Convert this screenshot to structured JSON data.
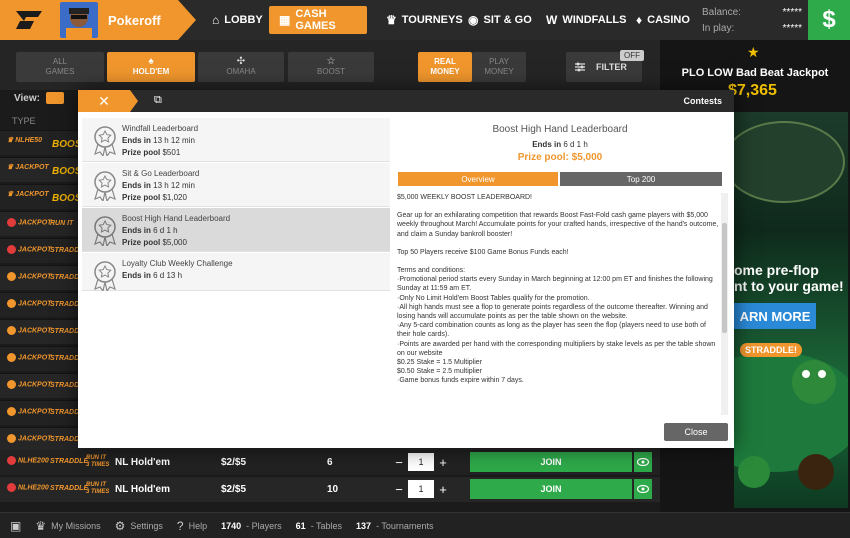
{
  "header": {
    "username": "Pokeroff",
    "nav": [
      {
        "label": "LOBBY",
        "icon": "home-icon",
        "glyph": "⌂"
      },
      {
        "label": "CASH GAMES",
        "icon": "cash-icon",
        "glyph": "▦"
      },
      {
        "label": "TOURNEYS",
        "icon": "trophy-icon",
        "glyph": "♛"
      },
      {
        "label": "SIT & GO",
        "icon": "chip-icon",
        "glyph": "◉"
      },
      {
        "label": "WINDFALLS",
        "icon": "windfall-icon",
        "glyph": "W"
      },
      {
        "label": "CASINO",
        "icon": "casino-icon",
        "glyph": "♦"
      }
    ],
    "balance_label": "Balance:",
    "balance_value": "*****",
    "inplay_label": "In play:",
    "inplay_value": "*****",
    "cashier_symbol": "$"
  },
  "filters": {
    "all_games": [
      "ALL",
      "GAMES"
    ],
    "holdem": "HOLD'EM",
    "omaha": "OMAHA",
    "boost": "BOOST",
    "real_money": [
      "REAL",
      "MONEY"
    ],
    "play_money": [
      "PLAY",
      "MONEY"
    ],
    "filter_label": "FILTER",
    "filter_state": "OFF",
    "view_label": "View:",
    "type_label": "TYPE"
  },
  "side": {
    "jackpot_title": "PLO LOW Bad Beat Jackpot",
    "jackpot_value": "$7,365",
    "ad_line1": "ome pre-flop",
    "ad_line2": "nt to your game!",
    "ad_button": "ARN MORE",
    "ad_tag": "STRADDLE!"
  },
  "list_badges": {
    "jackpot_small": "NLHE50",
    "jackpot_word": "JACKPOT",
    "boost_word": "BOOST",
    "straddle": "STRADDLE",
    "run_it": "RUN IT",
    "three_times": "3 TIMES"
  },
  "modal": {
    "title": "Contests",
    "close_label": "Close",
    "items": [
      {
        "name": "Windfall Leaderboard",
        "ends_label": "Ends in",
        "ends": "13 h 12 min",
        "prize_label": "Prize pool",
        "prize": "$501"
      },
      {
        "name": "Sit & Go Leaderboard",
        "ends_label": "Ends in",
        "ends": "13 h 12 min",
        "prize_label": "Prize pool",
        "prize": "$1,020"
      },
      {
        "name": "Boost High Hand Leaderboard",
        "ends_label": "Ends in",
        "ends": "6 d 1 h",
        "prize_label": "Prize pool",
        "prize": "$5,000"
      },
      {
        "name": "Loyalty Club Weekly Challenge",
        "ends_label": "Ends in",
        "ends": "6 d 13 h",
        "prize_label": "",
        "prize": ""
      }
    ],
    "detail": {
      "title": "Boost High Hand Leaderboard",
      "ends_label": "Ends in",
      "ends": "6 d 1 h",
      "prize": "Prize pool: $5,000",
      "tab_overview": "Overview",
      "tab_top": "Top 200",
      "p1": "$5,000 WEEKLY BOOST LEADERBOARD!",
      "p2": "Gear up for an exhilarating competition that rewards Boost Fast-Fold cash game players with $5,000 weekly throughout March! Accumulate points for your crafted hands, irrespective of the hand's outcome, and claim a Sunday bankroll booster!",
      "p3": "Top 50 Players receive $100 Game Bonus Funds each!",
      "terms": [
        "Terms and conditions:",
        "·Promotional period starts every Sunday in March beginning at 12:00 pm ET and finishes the following Sunday at 11:59 am ET.",
        "·Only No Limit Hold'em Boost Tables qualify for the promotion.",
        "·All high hands must see a flop to generate points regardless of the outcome thereafter. Winning and losing hands will accumulate points as per the table shown on the website.",
        "·Any 5-card combination counts as long as the player has seen the flop (players need to use both of their hole cards).",
        "·Points are awarded per hand with the corresponding multipliers by stake levels as per the table shown on our website",
        "$0.25 Stake = 1.5 Multiplier",
        "$0.50 Stake = 2.5 multiplier",
        "·Game bonus funds expire within 7 days."
      ]
    }
  },
  "games": [
    {
      "badge": "NLHE200",
      "name": "NL Hold'em",
      "stake": "$2/$5",
      "players": "6",
      "seats": "1",
      "join": "JOIN"
    },
    {
      "badge": "NLHE200",
      "name": "NL Hold'em",
      "stake": "$2/$5",
      "players": "10",
      "seats": "1",
      "join": "JOIN"
    }
  ],
  "footer": {
    "missions": "My Missions",
    "settings": "Settings",
    "help": "Help",
    "players_count": "1740",
    "players_label": "- Players",
    "tables_count": "61",
    "tables_label": "- Tables",
    "tourn_count": "137",
    "tourn_label": "- Tournaments"
  },
  "colors": {
    "accent": "#f0962d",
    "join": "#2eaa4a",
    "bg": "#1b1b1b"
  }
}
